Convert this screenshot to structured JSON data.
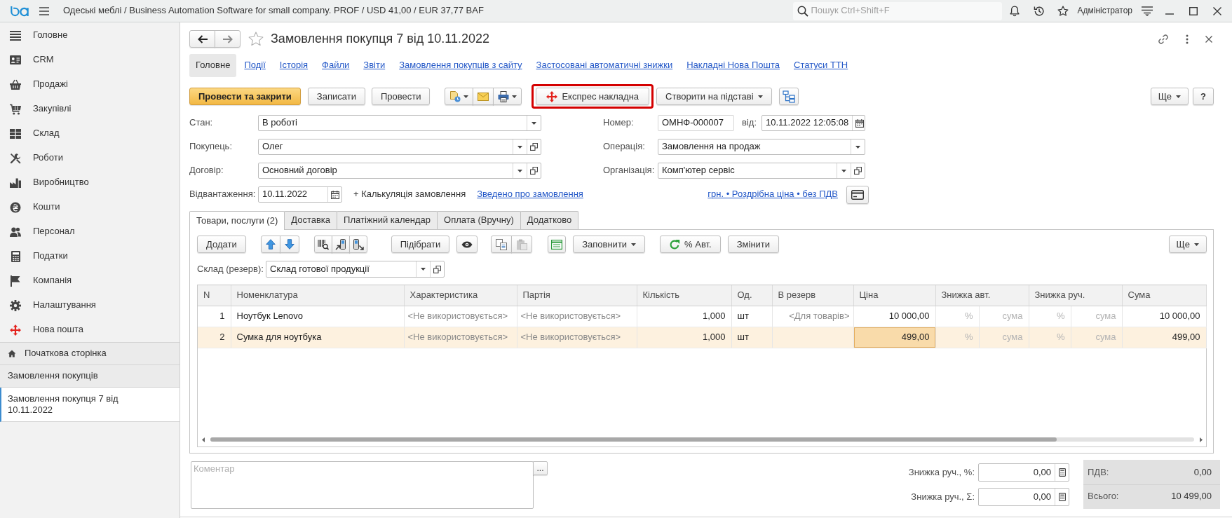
{
  "app_bar": {
    "title": "Одеські меблі / Business Automation Software for small company. PROF / USD 41,00 / EUR 37,77 BAF",
    "search": {
      "placeholder": "Пошук Ctrl+Shift+F"
    },
    "user": "Адміністратор"
  },
  "sidebar": {
    "sections": [
      {
        "label": "Головне"
      },
      {
        "label": "CRM"
      },
      {
        "label": "Продажі"
      },
      {
        "label": "Закупівлі"
      },
      {
        "label": "Склад"
      },
      {
        "label": "Роботи"
      },
      {
        "label": "Виробництво"
      },
      {
        "label": "Кошти"
      },
      {
        "label": "Персонал"
      },
      {
        "label": "Податки"
      },
      {
        "label": "Компанія"
      },
      {
        "label": "Налаштування"
      },
      {
        "label": "Нова пошта"
      }
    ],
    "windows": [
      {
        "label": "Початкова сторінка",
        "kind": "home",
        "selected": false
      },
      {
        "label": "Замовлення покупців",
        "kind": "list",
        "selected": false
      },
      {
        "label": "Замовлення покупця 7 від 10.11.2022",
        "kind": "document",
        "selected": true
      }
    ]
  },
  "form": {
    "title": "Замовлення покупця 7 від 10.11.2022",
    "favorite": false,
    "nav_links": [
      {
        "label": "Головне",
        "selected": true
      },
      {
        "label": "Події",
        "selected": false
      },
      {
        "label": "Історія",
        "selected": false
      },
      {
        "label": "Файли",
        "selected": false
      },
      {
        "label": "Звіти",
        "selected": false
      },
      {
        "label": "Замовлення покупців з сайту",
        "selected": false
      },
      {
        "label": "Застосовані автоматичні знижки",
        "selected": false
      },
      {
        "label": "Накладні Нова Пошта",
        "selected": false
      },
      {
        "label": "Статуси ТТН",
        "selected": false
      }
    ],
    "commands": {
      "post_and_close": "Провести та закрити",
      "save": "Записати",
      "post": "Провести",
      "express_waybill": {
        "label": "Експрес накладна",
        "highlighted": true
      },
      "create_based_on": "Створити на підставі",
      "more": "Ще",
      "help": "?"
    },
    "fields": {
      "status": {
        "label": "Стан:",
        "value": "В роботі"
      },
      "customer": {
        "label": "Покупець:",
        "value": "Олег"
      },
      "contract": {
        "label": "Договір:",
        "value": "Основний договір"
      },
      "shipment": {
        "label": "Відвантаження:",
        "value": "10.11.2022"
      },
      "calculation": "+ Калькуляція замовлення",
      "summary_link": "Зведено про замовлення",
      "number": {
        "label": "Номер:",
        "value": "ОМНФ-000007"
      },
      "date": {
        "label": "від:",
        "value": "10.11.2022 12:05:08"
      },
      "operation": {
        "label": "Операція:",
        "value": "Замовлення на продаж"
      },
      "organization": {
        "label": "Організація:",
        "value": "Комп'ютер сервіс"
      },
      "price_link": "грн. • Роздрібна ціна • без ПДВ"
    }
  },
  "tabs": [
    {
      "label": "Товари, послуги (2)",
      "selected": true
    },
    {
      "label": "Доставка",
      "selected": false
    },
    {
      "label": "Платіжний календар",
      "selected": false
    },
    {
      "label": "Оплата (Вручну)",
      "selected": false
    },
    {
      "label": "Додатково",
      "selected": false
    }
  ],
  "goods": {
    "toolbar": {
      "add": "Додати",
      "pick": "Підібрати",
      "paste_disabled": true,
      "fill": "Заповнити",
      "auto_discount": "% Авт.",
      "change": "Змінити",
      "more": "Ще"
    },
    "warehouse": {
      "label": "Склад (резерв):",
      "value": "Склад готової продукції"
    },
    "table": {
      "columns": [
        "N",
        "Номенклатура",
        "Характеристика",
        "Партія",
        "Кількість",
        "Од.",
        "В резерв",
        "Ціна",
        "Знижка авт.",
        "Знижка руч.",
        "Сума"
      ],
      "rows": [
        {
          "n": "1",
          "item": "Ноутбук Lenovo",
          "characteristic": "<Не використовується>",
          "batch": "<Не використовується>",
          "quantity": "1,000",
          "unit": "шт",
          "reserve": "<Для товарів>",
          "price": "10 000,00",
          "auto_discount_percent": "%",
          "auto_discount_amount": "сума",
          "manual_discount_percent": "%",
          "manual_discount_amount": "сума",
          "sum": "10 000,00",
          "selected": false,
          "price_focused": false
        },
        {
          "n": "2",
          "item": "Сумка для ноутбука",
          "characteristic": "<Не використовується>",
          "batch": "<Не використовується>",
          "quantity": "1,000",
          "unit": "шт",
          "price": "499,00",
          "auto_discount_percent": "%",
          "auto_discount_amount": "сума",
          "manual_discount_percent": "%",
          "manual_discount_amount": "сума",
          "sum": "499,00",
          "selected": true,
          "price_focused": true
        }
      ]
    }
  },
  "footer": {
    "comment": {
      "placeholder": "Коментар"
    },
    "comment_button": "...",
    "manual_discounts": [
      {
        "label": "Знижка руч., %:",
        "value": "0,00"
      },
      {
        "label": "Знижка руч., Σ:",
        "value": "0,00"
      }
    ],
    "totals": [
      {
        "label": "ПДВ:",
        "value": "0,00"
      },
      {
        "label": "Всього:",
        "value": "10 499,00"
      }
    ]
  }
}
